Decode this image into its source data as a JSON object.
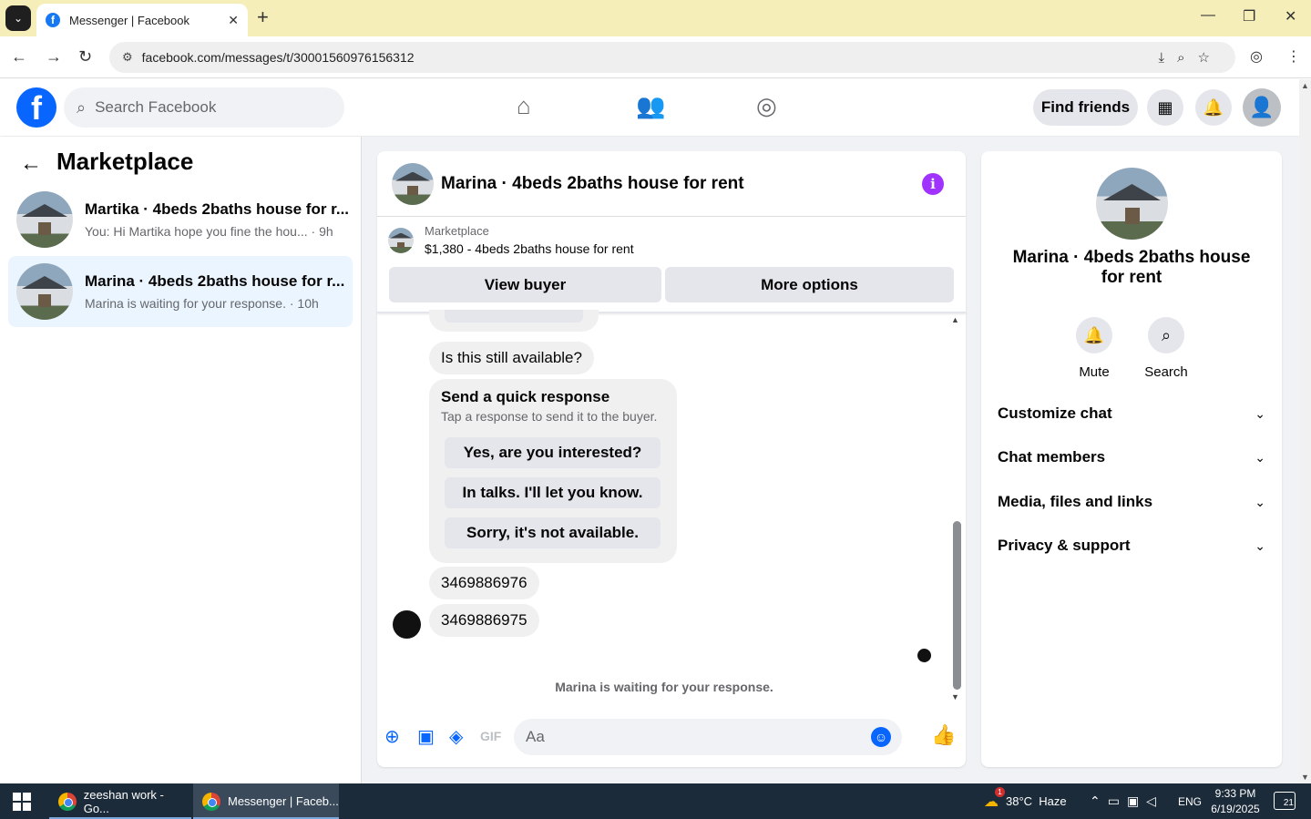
{
  "browser": {
    "tab_title": "Messenger | Facebook",
    "url": "facebook.com/messages/t/30001560976156312",
    "new_tab": "+",
    "close_tab": "✕"
  },
  "fb": {
    "search_placeholder": "Search Facebook",
    "find_friends": "Find friends"
  },
  "sidebar": {
    "title": "Marketplace",
    "conversations": [
      {
        "name": "Martika · 4beds 2baths house for r...",
        "preview": "You: Hi Martika hope you fine the hou... · 9h",
        "active": false
      },
      {
        "name": "Marina · 4beds 2baths house for r...",
        "preview": "Marina is waiting for your response. · 10h",
        "active": true
      }
    ]
  },
  "chat": {
    "title": "Marina · 4beds 2baths house for rent",
    "listing_label": "Marketplace",
    "listing_detail": "$1,380 - 4beds 2baths house for rent",
    "view_buyer": "View buyer",
    "more_options": "More options",
    "messages": {
      "still_available": "Is this still available?",
      "phone_1": "3469886976",
      "phone_2": "3469886975"
    },
    "quick_response": {
      "heading": "Send a quick response",
      "subtext": "Tap a response to send it to the buyer.",
      "options": [
        "Yes, are you interested?",
        "In talks. I'll let you know.",
        "Sorry, it's not available."
      ]
    },
    "waiting_note": "Marina is waiting for your response.",
    "input_placeholder": "Aa"
  },
  "info_panel": {
    "name": "Marina · 4beds 2baths house for rent",
    "actions": [
      {
        "label": "Mute",
        "icon": "bell-icon"
      },
      {
        "label": "Search",
        "icon": "search-icon"
      }
    ],
    "sections": [
      "Customize chat",
      "Chat members",
      "Media, files and links",
      "Privacy & support"
    ]
  },
  "taskbar": {
    "items": [
      {
        "label": "zeeshan work - Go..."
      },
      {
        "label": "Messenger | Faceb..."
      }
    ],
    "weather": "38°C  Haze",
    "language": "ENG",
    "time": "9:33 PM",
    "date": "6/19/2025",
    "notifications": "21",
    "weather_badge": "1"
  },
  "colors": {
    "fb_blue": "#0866ff",
    "active_convo": "#ebf5ff",
    "info_purple": "#a033ff"
  }
}
